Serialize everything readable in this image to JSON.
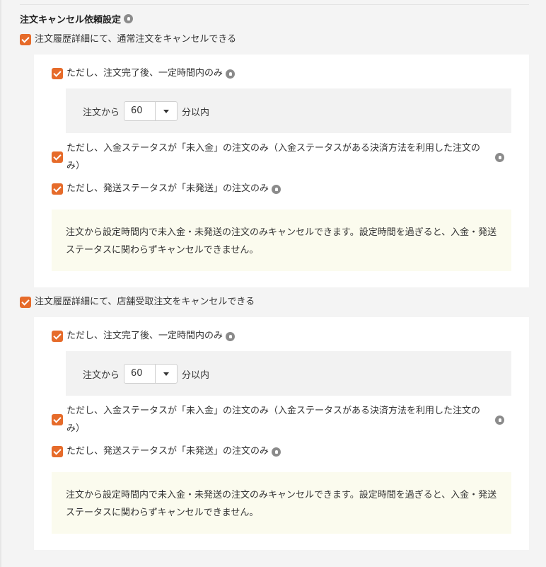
{
  "section": {
    "title": "注文キャンセル依頼設定"
  },
  "groups": [
    {
      "main_label": "注文履歴詳細にて、通常注文をキャンセルできる",
      "opt_time_label": "ただし、注文完了後、一定時間内のみ",
      "time_prefix": "注文から",
      "time_value": "60",
      "time_suffix": "分以内",
      "opt_unpaid_label": "ただし、入金ステータスが「未入金」の注文のみ（入金ステータスがある決済方法を利用した注文のみ）",
      "opt_unshipped_label": "ただし、発送ステータスが「未発送」の注文のみ",
      "note": "注文から設定時間内で未入金・未発送の注文のみキャンセルできます。設定時間を過ぎると、入金・発送ステータスに関わらずキャンセルできません。"
    },
    {
      "main_label": "注文履歴詳細にて、店舗受取注文をキャンセルできる",
      "opt_time_label": "ただし、注文完了後、一定時間内のみ",
      "time_prefix": "注文から",
      "time_value": "60",
      "time_suffix": "分以内",
      "opt_unpaid_label": "ただし、入金ステータスが「未入金」の注文のみ（入金ステータスがある決済方法を利用した注文のみ）",
      "opt_unshipped_label": "ただし、発送ステータスが「未発送」の注文のみ",
      "note": "注文から設定時間内で未入金・未発送の注文のみキャンセルできます。設定時間を過ぎると、入金・発送ステータスに関わらずキャンセルできません。"
    }
  ],
  "colors": {
    "accent": "#e66b2a",
    "note_bg": "#fbfbee",
    "panel_bg": "#ffffff",
    "page_bg": "#f4f4f4"
  },
  "icons": {
    "hint": "hint-icon",
    "checkbox": "checkmark-icon",
    "dropdown": "caret-down-icon"
  }
}
